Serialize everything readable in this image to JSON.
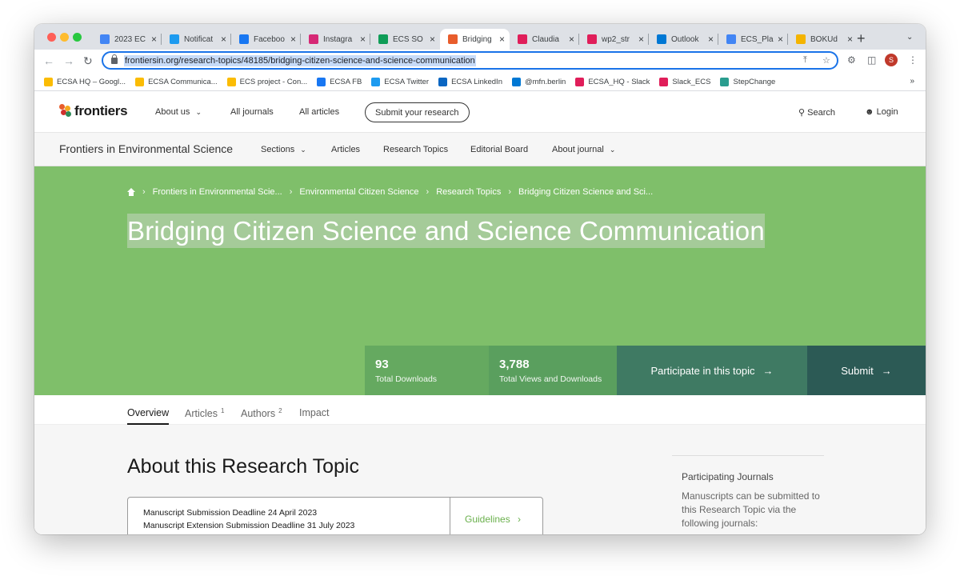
{
  "browser": {
    "tabs": [
      {
        "title": "2023 EC",
        "icon": "docs-icon",
        "color": "#4285f4"
      },
      {
        "title": "Notificat",
        "icon": "twitter-icon",
        "color": "#1d9bf0"
      },
      {
        "title": "Faceboo",
        "icon": "facebook-icon",
        "color": "#1877f2"
      },
      {
        "title": "Instagra",
        "icon": "instagram-icon",
        "color": "#d62976"
      },
      {
        "title": "ECS SO",
        "icon": "sheets-icon",
        "color": "#0f9d58"
      },
      {
        "title": "Bridging",
        "icon": "frontiers-icon",
        "color": "#e85d2c"
      },
      {
        "title": "Claudia",
        "icon": "slack-icon",
        "color": "#e01e5a"
      },
      {
        "title": "wp2_str",
        "icon": "slack-icon",
        "color": "#e01e5a"
      },
      {
        "title": "Outlook",
        "icon": "outlook-icon",
        "color": "#0078d4"
      },
      {
        "title": "ECS_Pla",
        "icon": "docs-icon",
        "color": "#4285f4"
      },
      {
        "title": "BOKUd",
        "icon": "folder-icon",
        "color": "#f4b400"
      }
    ],
    "url": "frontiersin.org/research-topics/48185/bridging-citizen-science-and-science-communication",
    "profile_initial": "S",
    "bookmarks": [
      {
        "label": "ECSA HQ – Googl...",
        "icon": "drive-icon",
        "color": "#fbbc04"
      },
      {
        "label": "ECSA Communica...",
        "icon": "drive-icon",
        "color": "#fbbc04"
      },
      {
        "label": "ECS project - Con...",
        "icon": "drive-icon",
        "color": "#fbbc04"
      },
      {
        "label": "ECSA FB",
        "icon": "facebook-icon",
        "color": "#1877f2"
      },
      {
        "label": "ECSA Twitter",
        "icon": "twitter-icon",
        "color": "#1d9bf0"
      },
      {
        "label": "ECSA LinkedIn",
        "icon": "linkedin-icon",
        "color": "#0a66c2"
      },
      {
        "label": "@mfn.berlin",
        "icon": "outlook-icon",
        "color": "#0078d4"
      },
      {
        "label": "ECSA_HQ - Slack",
        "icon": "slack-icon",
        "color": "#e01e5a"
      },
      {
        "label": "Slack_ECS",
        "icon": "slack-icon",
        "color": "#e01e5a"
      },
      {
        "label": "StepChange",
        "icon": "stepchange-icon",
        "color": "#2a9d8f"
      }
    ],
    "bookmarks_more": "»"
  },
  "site": {
    "logo": "frontiers",
    "nav": {
      "about_us": "About us",
      "all_journals": "All journals",
      "all_articles": "All articles",
      "submit_research": "Submit your research",
      "search": "Search",
      "login": "Login"
    },
    "journal_nav": {
      "title": "Frontiers in Environmental Science",
      "sections": "Sections",
      "articles": "Articles",
      "research_topics": "Research Topics",
      "editorial_board": "Editorial Board",
      "about_journal": "About journal"
    }
  },
  "hero": {
    "breadcrumbs": [
      "Frontiers in Environmental Scie...",
      "Environmental Citizen Science",
      "Research Topics",
      "Bridging Citizen Science and Sci..."
    ],
    "title": "Bridging Citizen Science and Science Communication",
    "stats": [
      {
        "value": "93",
        "label": "Total Downloads"
      },
      {
        "value": "3,788",
        "label": "Total Views and Downloads"
      }
    ],
    "participate_label": "Participate in this topic",
    "submit_label": "Submit",
    "colors": {
      "hero": "#7fbf6a",
      "stat1": "#65a960",
      "stat2": "#5a9f5e",
      "participate": "#3f7a63",
      "submit": "#2c5a55"
    }
  },
  "page_tabs": [
    {
      "label": "Overview",
      "count": ""
    },
    {
      "label": "Articles",
      "count": "1"
    },
    {
      "label": "Authors",
      "count": "2"
    },
    {
      "label": "Impact",
      "count": ""
    }
  ],
  "content": {
    "heading": "About this Research Topic",
    "deadline_1": "Manuscript Submission Deadline 24 April 2023",
    "deadline_2": "Manuscript Extension Submission Deadline 31 July 2023",
    "guidelines": "Guidelines",
    "sidebar_heading": "Participating Journals",
    "sidebar_text": "Manuscripts can be submitted to this Research Topic via the following journals:"
  }
}
